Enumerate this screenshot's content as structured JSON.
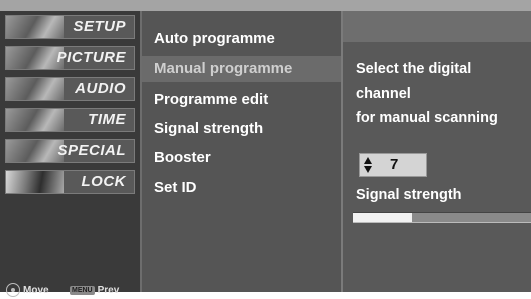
{
  "left_panel": {
    "items": [
      {
        "label": "SETUP",
        "icon": "setup-thumbnail"
      },
      {
        "label": "PICTURE",
        "icon": "picture-thumbnail"
      },
      {
        "label": "AUDIO",
        "icon": "audio-thumbnail"
      },
      {
        "label": "TIME",
        "icon": "time-thumbnail"
      },
      {
        "label": "SPECIAL",
        "icon": "special-thumbnail"
      },
      {
        "label": "LOCK",
        "icon": "lock-thumbnail"
      }
    ],
    "hints": {
      "move_label": "Move",
      "menu_key": "MENU",
      "prev_label": "Prev"
    }
  },
  "main_menu": {
    "items": [
      "Auto programme",
      "Manual programme",
      "Programme edit",
      "Signal strength",
      "Booster",
      "Set ID"
    ],
    "selected_index": 1
  },
  "detail": {
    "lines": [
      "Select the digital",
      "channel",
      "for manual scanning"
    ],
    "channel_value": "7",
    "signal_label": "Signal strength",
    "signal_level_fraction": 0.33
  }
}
